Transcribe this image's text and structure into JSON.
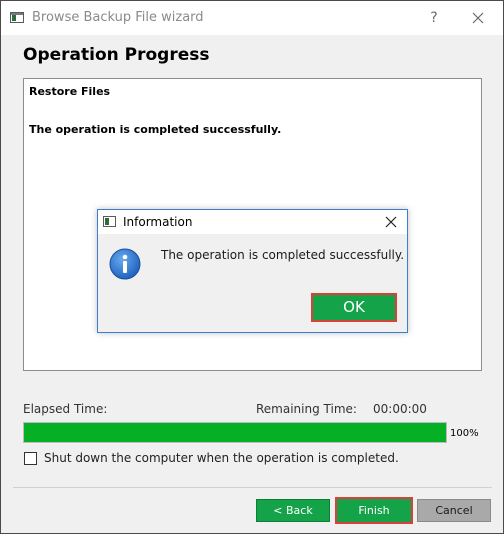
{
  "window": {
    "title": "Browse Backup File wizard",
    "help_label": "?"
  },
  "page": {
    "title": "Operation Progress"
  },
  "log": {
    "lines": [
      "Restore Files",
      "The operation is completed successfully."
    ]
  },
  "progress": {
    "elapsed_label": "Elapsed Time:",
    "remaining_label": "Remaining Time:",
    "remaining_value": "00:00:00",
    "percent_label": "100%",
    "fraction": 1.0
  },
  "shutdown": {
    "label": "Shut down the computer when the operation is completed.",
    "checked": false
  },
  "buttons": {
    "back": "< Back",
    "finish": "Finish",
    "cancel": "Cancel"
  },
  "dialog": {
    "title": "Information",
    "message": "The operation is completed successfully.",
    "ok": "OK"
  },
  "colors": {
    "accent_green": "#15a34a",
    "progress_green": "#06b025",
    "highlight_red": "#d9403a",
    "dialog_border": "#3c7fd0",
    "info_blue": "#1f64c0"
  }
}
